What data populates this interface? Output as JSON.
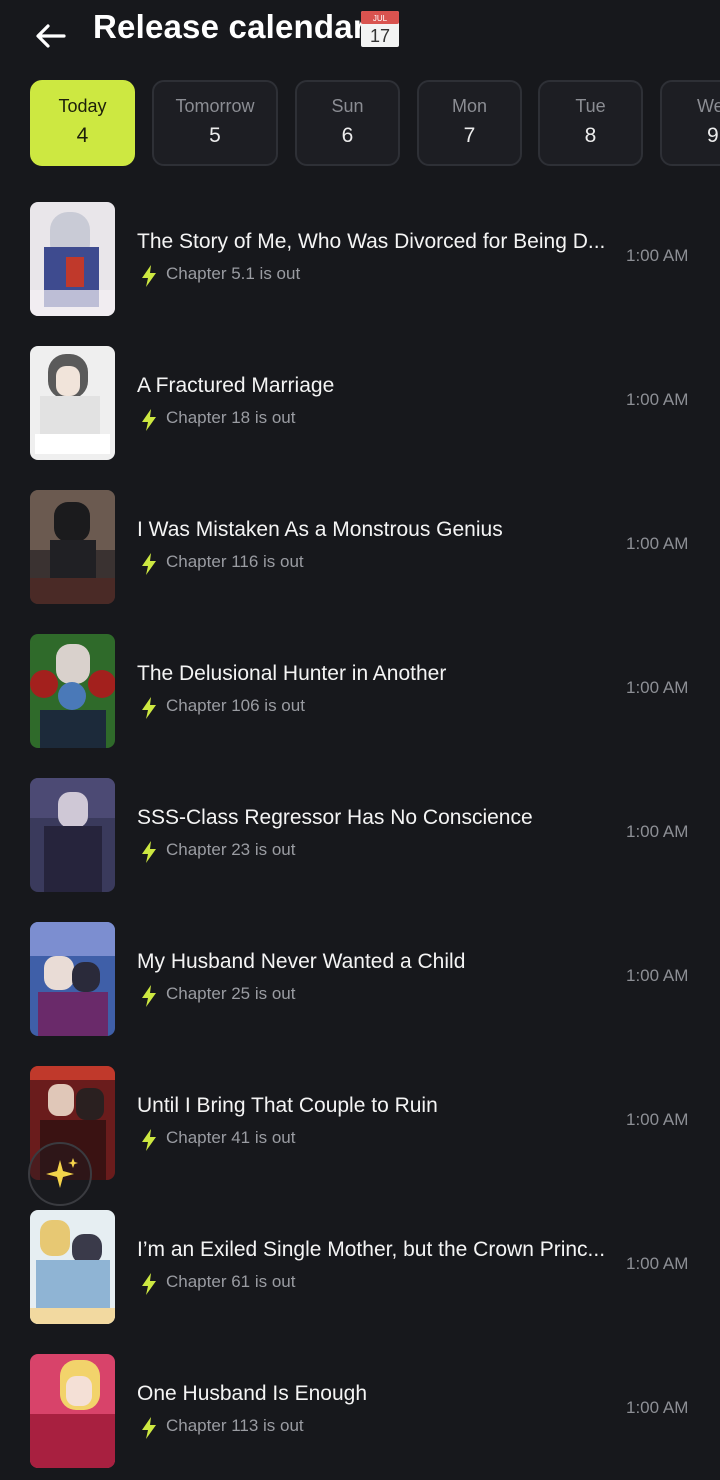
{
  "header": {
    "title": "Release calendar",
    "calendar_emoji_month": "JUL",
    "calendar_emoji_day": "17"
  },
  "days": [
    {
      "name": "Today",
      "num": "4",
      "active": true
    },
    {
      "name": "Tomorrow",
      "num": "5"
    },
    {
      "name": "Sun",
      "num": "6"
    },
    {
      "name": "Mon",
      "num": "7"
    },
    {
      "name": "Tue",
      "num": "8"
    },
    {
      "name": "We",
      "num": "9"
    }
  ],
  "releases": [
    {
      "title": "The Story of Me, Who Was Divorced for Being D...",
      "chapter": "Chapter 5.1 is out",
      "time": "1:00 AM"
    },
    {
      "title": "A Fractured Marriage",
      "chapter": "Chapter 18 is out",
      "time": "1:00 AM"
    },
    {
      "title": "I Was Mistaken As a Monstrous Genius",
      "chapter": "Chapter 116 is out",
      "time": "1:00 AM"
    },
    {
      "title": "The Delusional Hunter in Another",
      "chapter": "Chapter 106 is out",
      "time": "1:00 AM"
    },
    {
      "title": "SSS-Class Regressor Has No Conscience",
      "chapter": "Chapter 23 is out",
      "time": "1:00 AM"
    },
    {
      "title": "My Husband Never Wanted a Child",
      "chapter": "Chapter 25 is out",
      "time": "1:00 AM"
    },
    {
      "title": "Until I Bring That Couple to Ruin",
      "chapter": "Chapter 41 is out",
      "time": "1:00 AM"
    },
    {
      "title": "I’m an Exiled Single Mother, but the Crown Princ...",
      "chapter": "Chapter 61 is out",
      "time": "1:00 AM"
    },
    {
      "title": "One Husband Is Enough",
      "chapter": "Chapter 113 is out",
      "time": "1:00 AM"
    }
  ],
  "colors": {
    "accent": "#cde841",
    "bolt": "#cde841",
    "background": "#17181c"
  }
}
